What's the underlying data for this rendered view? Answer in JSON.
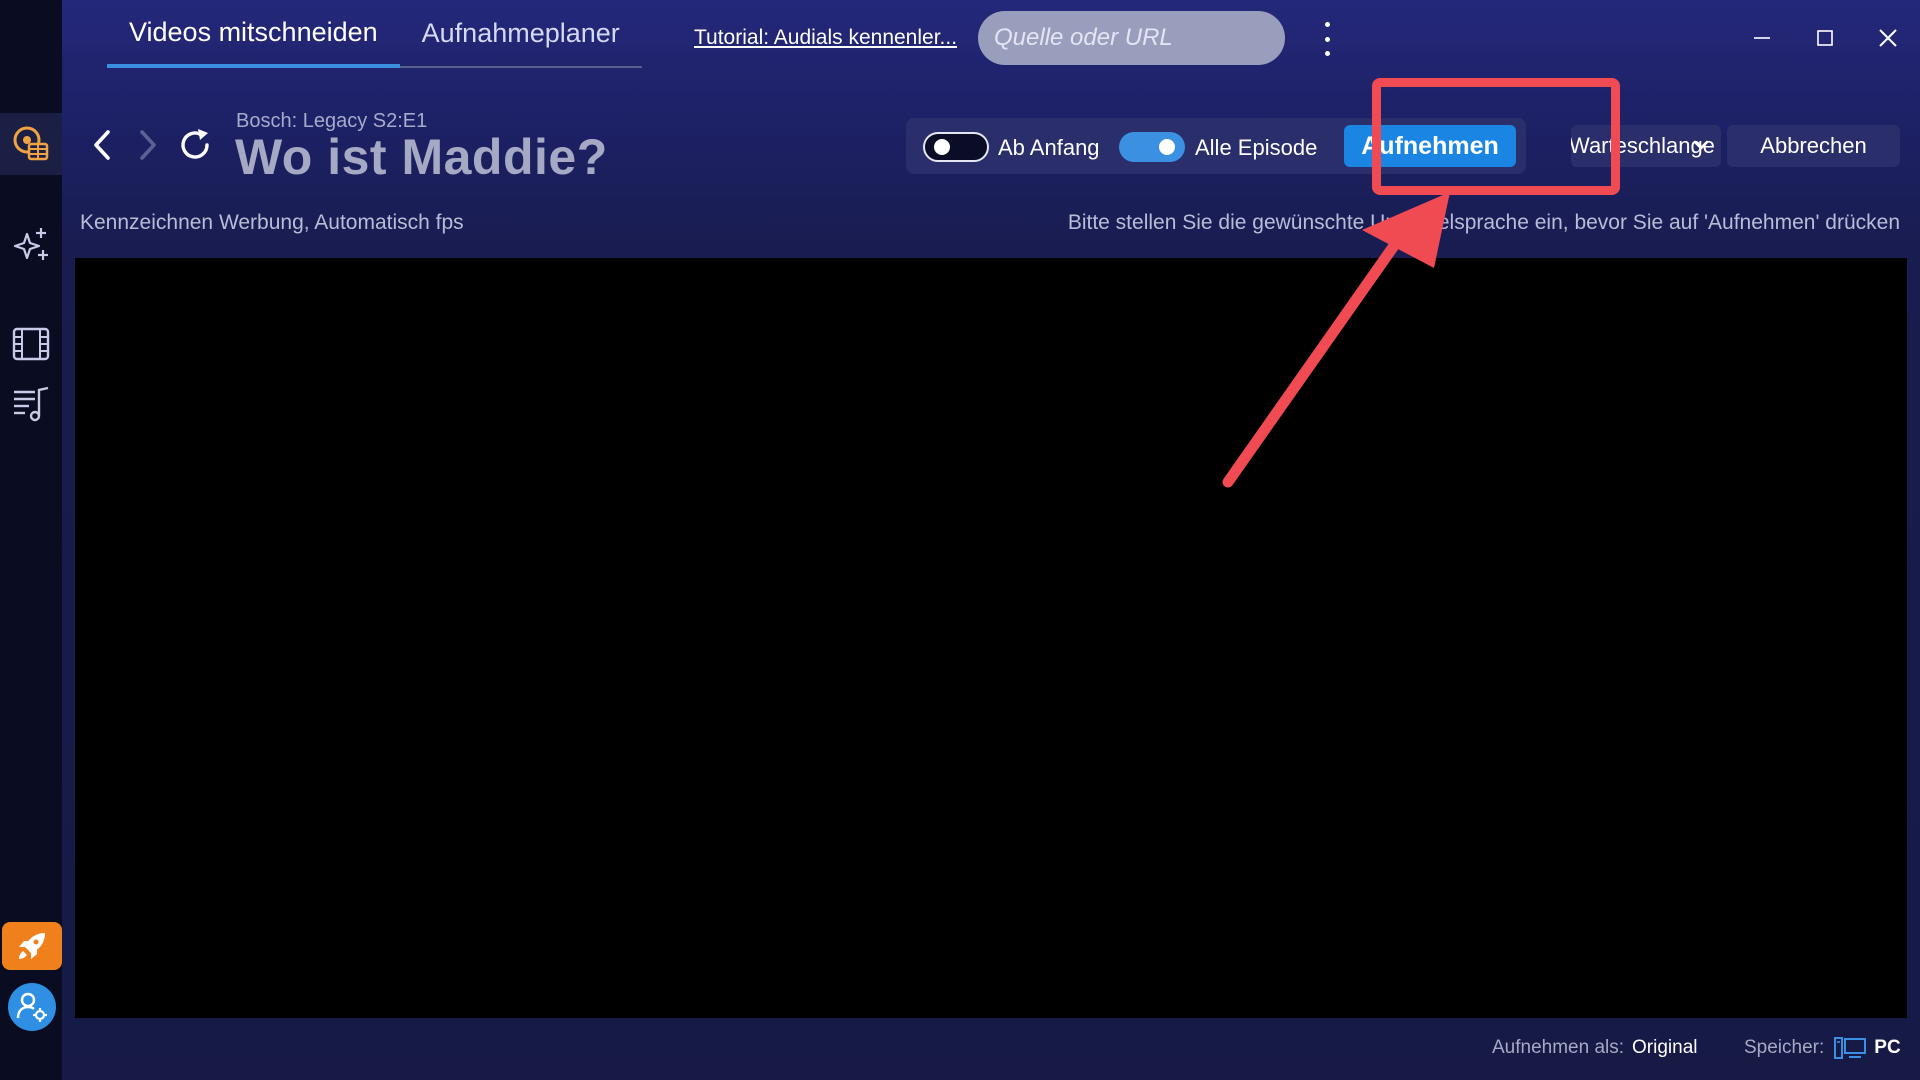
{
  "tabs": [
    {
      "label": "Videos mitschneiden",
      "active": true
    },
    {
      "label": "Aufnahmeplaner",
      "active": false
    }
  ],
  "header": {
    "tutorial_link": "Tutorial: Audials kennenler...",
    "search_placeholder": "Quelle oder URL"
  },
  "media": {
    "show": "Bosch: Legacy S2:E1",
    "title": "Wo ist Maddie?"
  },
  "toolbar": {
    "toggle_start_label": "Ab Anfang",
    "toggle_start_on": false,
    "toggle_all_label": "Alle Episode",
    "toggle_all_on": true,
    "record_label": "Aufnehmen",
    "queue_label": "Warteschlange",
    "cancel_label": "Abbrechen"
  },
  "info": {
    "left": "Kennzeichnen Werbung, Automatisch fps",
    "right": "Bitte stellen Sie die gewünschte Untertitelsprache ein, bevor Sie auf 'Aufnehmen' drücken"
  },
  "status": {
    "record_as_label": "Aufnehmen als:",
    "record_as_value": "Original",
    "storage_label": "Speicher:",
    "storage_value": "PC"
  },
  "sidebar": {
    "items": [
      "video-recorder-icon",
      "magic-sparkle-icon",
      "film-icon",
      "music-playlist-icon"
    ],
    "bottom": [
      "rocket-icon",
      "user-settings-icon"
    ]
  },
  "colors": {
    "accent": "#1a85e2",
    "highlight": "#f04a52",
    "rocket": "#f0801c"
  }
}
